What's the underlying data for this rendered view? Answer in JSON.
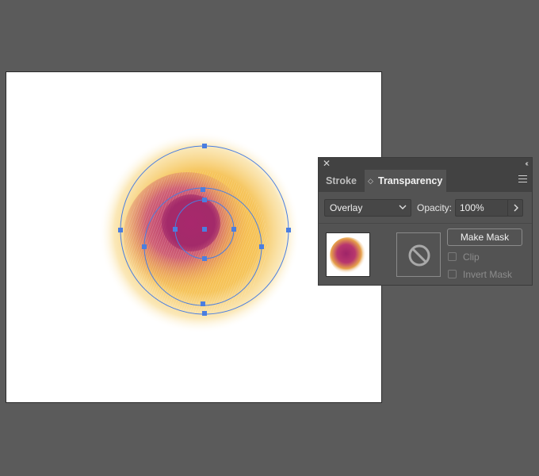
{
  "panel": {
    "close_icon": "close-icon",
    "collapse_label": "‹‹",
    "tabs": [
      {
        "label": "Stroke",
        "active": false
      },
      {
        "label": "Transparency",
        "active": true
      }
    ],
    "menu_icon": "hamburger-menu-icon",
    "blend_mode": "Overlay",
    "opacity_label": "Opacity:",
    "opacity_value": "100%",
    "make_mask_label": "Make Mask",
    "clip_label": "Clip",
    "clip_checked": false,
    "invert_mask_label": "Invert Mask",
    "invert_mask_checked": false
  },
  "colors": {
    "workspace": "#5b5b5b",
    "artboard": "#ffffff",
    "panel_bg": "#535353",
    "selection": "#4a7ee0",
    "gradient_outer": "#f3c85a",
    "gradient_inner": "#a52a6e"
  }
}
